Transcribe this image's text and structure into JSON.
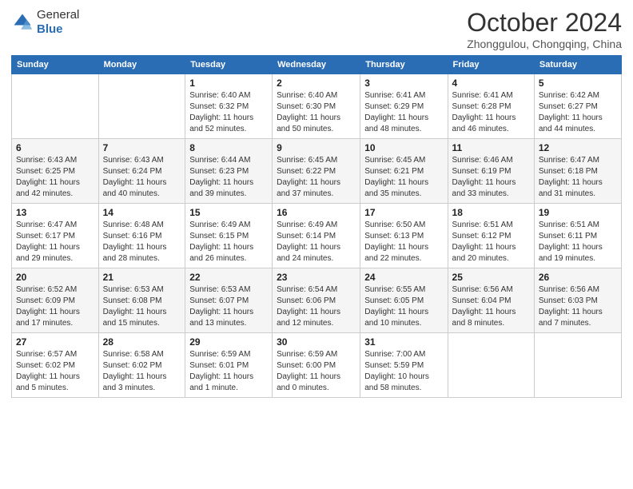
{
  "logo": {
    "general": "General",
    "blue": "Blue"
  },
  "title": {
    "month": "October 2024",
    "location": "Zhonggulou, Chongqing, China"
  },
  "weekdays": [
    "Sunday",
    "Monday",
    "Tuesday",
    "Wednesday",
    "Thursday",
    "Friday",
    "Saturday"
  ],
  "weeks": [
    [
      {
        "day": "",
        "detail": ""
      },
      {
        "day": "",
        "detail": ""
      },
      {
        "day": "1",
        "sunrise": "Sunrise: 6:40 AM",
        "sunset": "Sunset: 6:32 PM",
        "daylight": "Daylight: 11 hours and 52 minutes."
      },
      {
        "day": "2",
        "sunrise": "Sunrise: 6:40 AM",
        "sunset": "Sunset: 6:30 PM",
        "daylight": "Daylight: 11 hours and 50 minutes."
      },
      {
        "day": "3",
        "sunrise": "Sunrise: 6:41 AM",
        "sunset": "Sunset: 6:29 PM",
        "daylight": "Daylight: 11 hours and 48 minutes."
      },
      {
        "day": "4",
        "sunrise": "Sunrise: 6:41 AM",
        "sunset": "Sunset: 6:28 PM",
        "daylight": "Daylight: 11 hours and 46 minutes."
      },
      {
        "day": "5",
        "sunrise": "Sunrise: 6:42 AM",
        "sunset": "Sunset: 6:27 PM",
        "daylight": "Daylight: 11 hours and 44 minutes."
      }
    ],
    [
      {
        "day": "6",
        "sunrise": "Sunrise: 6:43 AM",
        "sunset": "Sunset: 6:25 PM",
        "daylight": "Daylight: 11 hours and 42 minutes."
      },
      {
        "day": "7",
        "sunrise": "Sunrise: 6:43 AM",
        "sunset": "Sunset: 6:24 PM",
        "daylight": "Daylight: 11 hours and 40 minutes."
      },
      {
        "day": "8",
        "sunrise": "Sunrise: 6:44 AM",
        "sunset": "Sunset: 6:23 PM",
        "daylight": "Daylight: 11 hours and 39 minutes."
      },
      {
        "day": "9",
        "sunrise": "Sunrise: 6:45 AM",
        "sunset": "Sunset: 6:22 PM",
        "daylight": "Daylight: 11 hours and 37 minutes."
      },
      {
        "day": "10",
        "sunrise": "Sunrise: 6:45 AM",
        "sunset": "Sunset: 6:21 PM",
        "daylight": "Daylight: 11 hours and 35 minutes."
      },
      {
        "day": "11",
        "sunrise": "Sunrise: 6:46 AM",
        "sunset": "Sunset: 6:19 PM",
        "daylight": "Daylight: 11 hours and 33 minutes."
      },
      {
        "day": "12",
        "sunrise": "Sunrise: 6:47 AM",
        "sunset": "Sunset: 6:18 PM",
        "daylight": "Daylight: 11 hours and 31 minutes."
      }
    ],
    [
      {
        "day": "13",
        "sunrise": "Sunrise: 6:47 AM",
        "sunset": "Sunset: 6:17 PM",
        "daylight": "Daylight: 11 hours and 29 minutes."
      },
      {
        "day": "14",
        "sunrise": "Sunrise: 6:48 AM",
        "sunset": "Sunset: 6:16 PM",
        "daylight": "Daylight: 11 hours and 28 minutes."
      },
      {
        "day": "15",
        "sunrise": "Sunrise: 6:49 AM",
        "sunset": "Sunset: 6:15 PM",
        "daylight": "Daylight: 11 hours and 26 minutes."
      },
      {
        "day": "16",
        "sunrise": "Sunrise: 6:49 AM",
        "sunset": "Sunset: 6:14 PM",
        "daylight": "Daylight: 11 hours and 24 minutes."
      },
      {
        "day": "17",
        "sunrise": "Sunrise: 6:50 AM",
        "sunset": "Sunset: 6:13 PM",
        "daylight": "Daylight: 11 hours and 22 minutes."
      },
      {
        "day": "18",
        "sunrise": "Sunrise: 6:51 AM",
        "sunset": "Sunset: 6:12 PM",
        "daylight": "Daylight: 11 hours and 20 minutes."
      },
      {
        "day": "19",
        "sunrise": "Sunrise: 6:51 AM",
        "sunset": "Sunset: 6:11 PM",
        "daylight": "Daylight: 11 hours and 19 minutes."
      }
    ],
    [
      {
        "day": "20",
        "sunrise": "Sunrise: 6:52 AM",
        "sunset": "Sunset: 6:09 PM",
        "daylight": "Daylight: 11 hours and 17 minutes."
      },
      {
        "day": "21",
        "sunrise": "Sunrise: 6:53 AM",
        "sunset": "Sunset: 6:08 PM",
        "daylight": "Daylight: 11 hours and 15 minutes."
      },
      {
        "day": "22",
        "sunrise": "Sunrise: 6:53 AM",
        "sunset": "Sunset: 6:07 PM",
        "daylight": "Daylight: 11 hours and 13 minutes."
      },
      {
        "day": "23",
        "sunrise": "Sunrise: 6:54 AM",
        "sunset": "Sunset: 6:06 PM",
        "daylight": "Daylight: 11 hours and 12 minutes."
      },
      {
        "day": "24",
        "sunrise": "Sunrise: 6:55 AM",
        "sunset": "Sunset: 6:05 PM",
        "daylight": "Daylight: 11 hours and 10 minutes."
      },
      {
        "day": "25",
        "sunrise": "Sunrise: 6:56 AM",
        "sunset": "Sunset: 6:04 PM",
        "daylight": "Daylight: 11 hours and 8 minutes."
      },
      {
        "day": "26",
        "sunrise": "Sunrise: 6:56 AM",
        "sunset": "Sunset: 6:03 PM",
        "daylight": "Daylight: 11 hours and 7 minutes."
      }
    ],
    [
      {
        "day": "27",
        "sunrise": "Sunrise: 6:57 AM",
        "sunset": "Sunset: 6:02 PM",
        "daylight": "Daylight: 11 hours and 5 minutes."
      },
      {
        "day": "28",
        "sunrise": "Sunrise: 6:58 AM",
        "sunset": "Sunset: 6:02 PM",
        "daylight": "Daylight: 11 hours and 3 minutes."
      },
      {
        "day": "29",
        "sunrise": "Sunrise: 6:59 AM",
        "sunset": "Sunset: 6:01 PM",
        "daylight": "Daylight: 11 hours and 1 minute."
      },
      {
        "day": "30",
        "sunrise": "Sunrise: 6:59 AM",
        "sunset": "Sunset: 6:00 PM",
        "daylight": "Daylight: 11 hours and 0 minutes."
      },
      {
        "day": "31",
        "sunrise": "Sunrise: 7:00 AM",
        "sunset": "Sunset: 5:59 PM",
        "daylight": "Daylight: 10 hours and 58 minutes."
      },
      {
        "day": "",
        "detail": ""
      },
      {
        "day": "",
        "detail": ""
      }
    ]
  ]
}
